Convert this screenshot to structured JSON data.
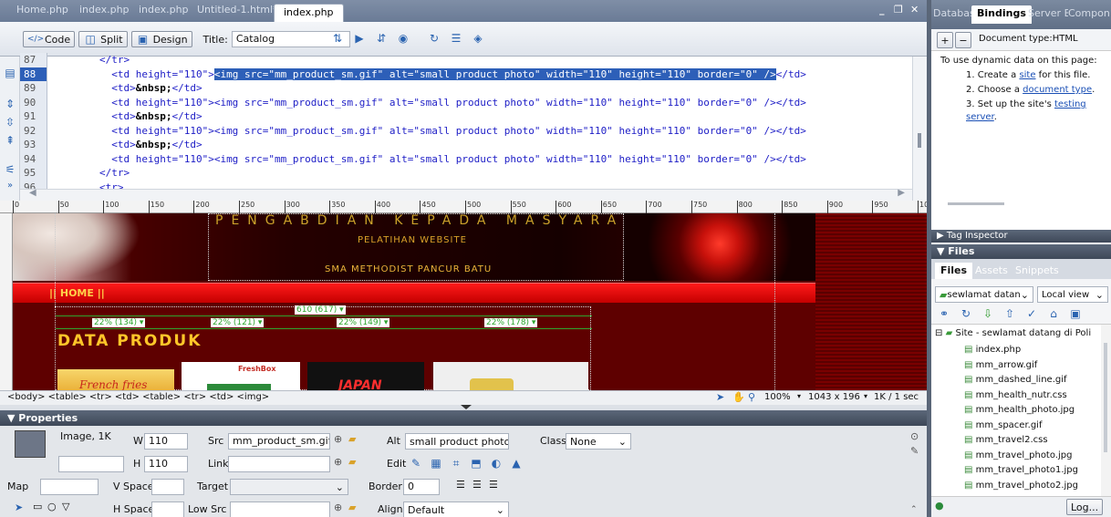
{
  "doc_tabs": [
    "Home.php",
    "index.php",
    "index.php",
    "Untitled-1.html*",
    "index.php"
  ],
  "window_controls": {
    "min": "_",
    "restore": "❐",
    "close": "✕"
  },
  "view_buttons": {
    "code": "Code",
    "split": "Split",
    "design": "Design"
  },
  "title_label": "Title:",
  "title_value": "Catalog",
  "code": {
    "line_numbers": [
      "87",
      "88",
      "89",
      "90",
      "91",
      "92",
      "93",
      "94",
      "95",
      "96"
    ],
    "lines": [
      {
        "indent": "        ",
        "parts": [
          {
            "t": "</tr>",
            "c": "tag"
          }
        ]
      },
      {
        "indent": "          ",
        "parts": [
          {
            "t": "<td height=\"110\">",
            "c": "tag"
          },
          {
            "t": "<img src=\"mm_product_sm.gif\" alt=\"small product photo\" width=\"110\" height=\"110\" border=\"0\" />",
            "c": "hl"
          },
          {
            "t": "</td>",
            "c": "tag"
          }
        ]
      },
      {
        "indent": "          ",
        "parts": [
          {
            "t": "<td>",
            "c": "tag"
          },
          {
            "t": "&nbsp;",
            "c": "ent"
          },
          {
            "t": "</td>",
            "c": "tag"
          }
        ]
      },
      {
        "indent": "          ",
        "parts": [
          {
            "t": "<td height=\"110\"><img src=\"mm_product_sm.gif\" alt=\"small product photo\" width=\"110\" height=\"110\" border=\"0\" /></td>",
            "c": "tag"
          }
        ]
      },
      {
        "indent": "          ",
        "parts": [
          {
            "t": "<td>",
            "c": "tag"
          },
          {
            "t": "&nbsp;",
            "c": "ent"
          },
          {
            "t": "</td>",
            "c": "tag"
          }
        ]
      },
      {
        "indent": "          ",
        "parts": [
          {
            "t": "<td height=\"110\"><img src=\"mm_product_sm.gif\" alt=\"small product photo\" width=\"110\" height=\"110\" border=\"0\" /></td>",
            "c": "tag"
          }
        ]
      },
      {
        "indent": "          ",
        "parts": [
          {
            "t": "<td>",
            "c": "tag"
          },
          {
            "t": "&nbsp;",
            "c": "ent"
          },
          {
            "t": "</td>",
            "c": "tag"
          }
        ]
      },
      {
        "indent": "          ",
        "parts": [
          {
            "t": "<td height=\"110\"><img src=\"mm_product_sm.gif\" alt=\"small product photo\" width=\"110\" height=\"110\" border=\"0\" /></td>",
            "c": "tag"
          }
        ]
      },
      {
        "indent": "        ",
        "parts": [
          {
            "t": "</tr>",
            "c": "tag"
          }
        ]
      },
      {
        "indent": "        ",
        "parts": [
          {
            "t": "<tr>",
            "c": "tag"
          }
        ]
      }
    ]
  },
  "ruler": [
    "0",
    "50",
    "100",
    "150",
    "200",
    "250",
    "300",
    "350",
    "400",
    "450",
    "500",
    "550",
    "600",
    "650",
    "700",
    "750",
    "800",
    "850",
    "900",
    "950",
    "1000"
  ],
  "design": {
    "header_big": "PENGABDIAN KEPADA MASYARAKAT",
    "header_sub": "PELATIHAN WEBSITE",
    "school": "SMA METHODIST PANCUR BATU",
    "nav": "|| HOME ||",
    "table_width": "610 (617) ▾",
    "cols": [
      "22% (134) ▾",
      "22% (121) ▾",
      "22% (149) ▾",
      "22% (178) ▾"
    ],
    "section_title": "DATA PRODUK",
    "products": [
      "French fries",
      "FreshBox",
      "JAPAN"
    ]
  },
  "status": {
    "tag_path": "<body> <table> <tr> <td> <table> <tr> <td> <img>",
    "zoom": "100%",
    "size": "1043 x 196",
    "download": "1K / 1 sec"
  },
  "properties": {
    "header": "Properties",
    "type": "Image, 1K",
    "w_label": "W",
    "w": "110",
    "h_label": "H",
    "h": "110",
    "src_label": "Src",
    "src": "mm_product_sm.gif",
    "alt_label": "Alt",
    "alt": "small product photo",
    "class_label": "Class",
    "class": "None",
    "link_label": "Link",
    "edit_label": "Edit",
    "map_label": "Map",
    "vspace_label": "V Space",
    "target_label": "Target",
    "border_label": "Border",
    "border": "0",
    "hspace_label": "H Space",
    "lowsrc_label": "Low Src",
    "align_label": "Align",
    "align": "Default"
  },
  "right": {
    "top_tabs": [
      "Databas",
      "Bindings",
      "Server Be",
      "Compon"
    ],
    "doc_type": "Document type:HTML",
    "intro": "To use dynamic data on this page:",
    "steps": [
      {
        "pre": "1. Create a ",
        "link": "site",
        "post": " for this file."
      },
      {
        "pre": "2. Choose a ",
        "link": "document type",
        "post": "."
      },
      {
        "pre": "3. Set up the site's ",
        "link": "testing server",
        "post": "."
      }
    ],
    "tag_inspector": "Tag Inspector",
    "files_header": "Files",
    "files_tabs": [
      "Files",
      "Assets",
      "Snippets"
    ],
    "site_select": "sewlamat datan",
    "view_select": "Local view",
    "root": "Site - sewlamat datang di Poli",
    "files": [
      "index.php",
      "mm_arrow.gif",
      "mm_dashed_line.gif",
      "mm_health_nutr.css",
      "mm_health_photo.jpg",
      "mm_spacer.gif",
      "mm_travel2.css",
      "mm_travel_photo.jpg",
      "mm_travel_photo1.jpg",
      "mm_travel_photo2.jpg"
    ],
    "log": "Log..."
  }
}
